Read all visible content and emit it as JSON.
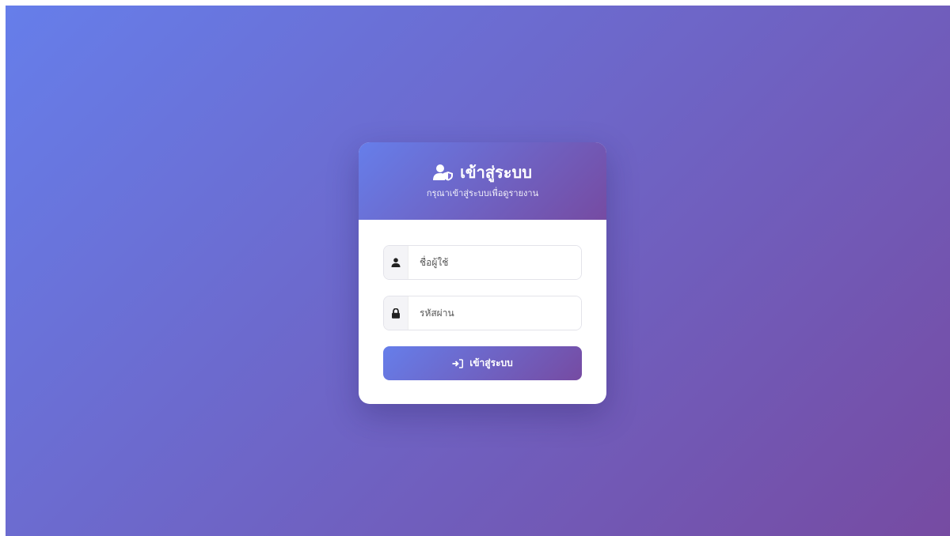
{
  "header": {
    "title": "เข้าสู่ระบบ",
    "subtitle": "กรุณาเข้าสู่ระบบเพื่อดูรายงาน",
    "icon": "user-shield-icon"
  },
  "form": {
    "username": {
      "placeholder": "ชื่อผู้ใช้",
      "value": "",
      "icon": "user-icon"
    },
    "password": {
      "placeholder": "รหัสผ่าน",
      "value": "",
      "icon": "lock-icon"
    },
    "submit": {
      "label": "เข้าสู่ระบบ",
      "icon": "sign-in-icon"
    }
  },
  "colors": {
    "gradient_start": "#667eea",
    "gradient_end": "#764ba2",
    "card_bg": "#ffffff"
  }
}
